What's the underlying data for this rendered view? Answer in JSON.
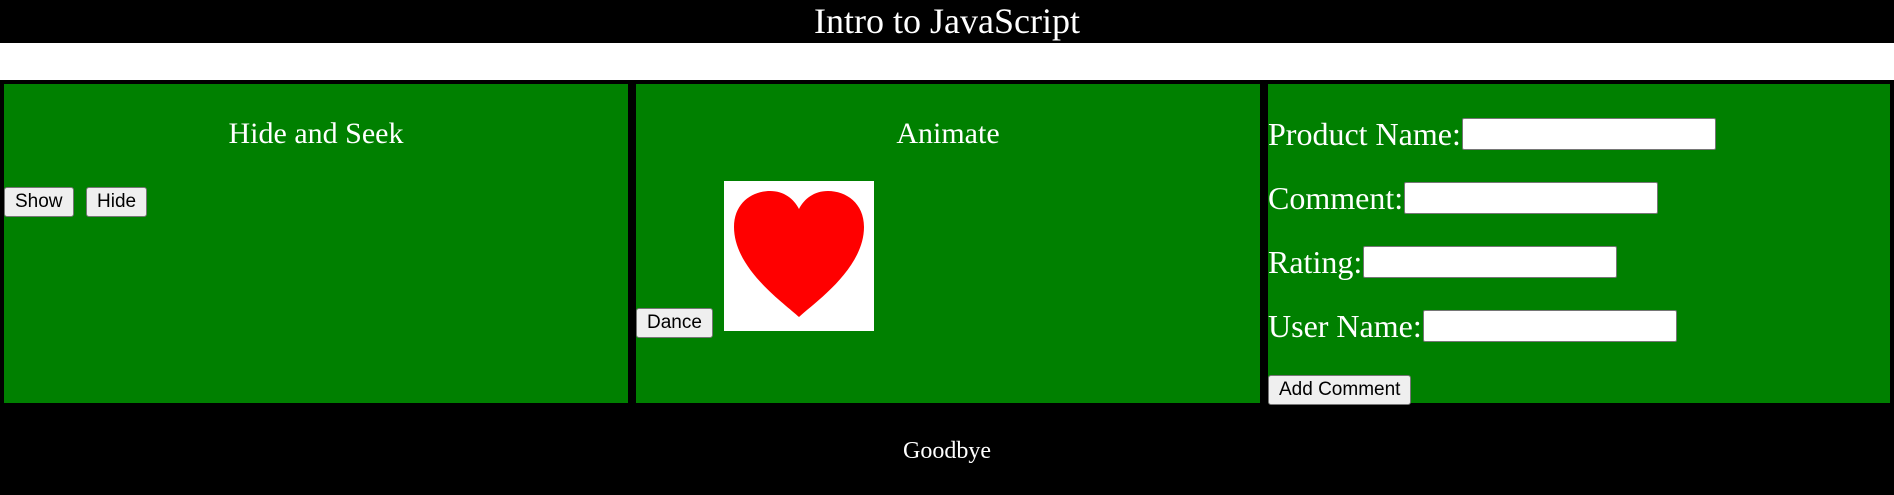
{
  "header": {
    "title": "Intro to JavaScript"
  },
  "hide_and_seek": {
    "title": "Hide and Seek",
    "show_label": "Show",
    "hide_label": "Hide"
  },
  "animate": {
    "title": "Animate",
    "dance_label": "Dance",
    "image_icon": "heart-icon",
    "heart_color": "#ff0000"
  },
  "comment_form": {
    "fields": [
      {
        "label": "Product Name:",
        "value": ""
      },
      {
        "label": "Comment:",
        "value": ""
      },
      {
        "label": "Rating:",
        "value": ""
      },
      {
        "label": "User Name:",
        "value": ""
      }
    ],
    "submit_label": "Add Comment"
  },
  "footer": {
    "text": "Goodbye"
  },
  "colors": {
    "panel_bg": "#008000",
    "bar_bg": "#000000",
    "text": "#ffffff"
  }
}
